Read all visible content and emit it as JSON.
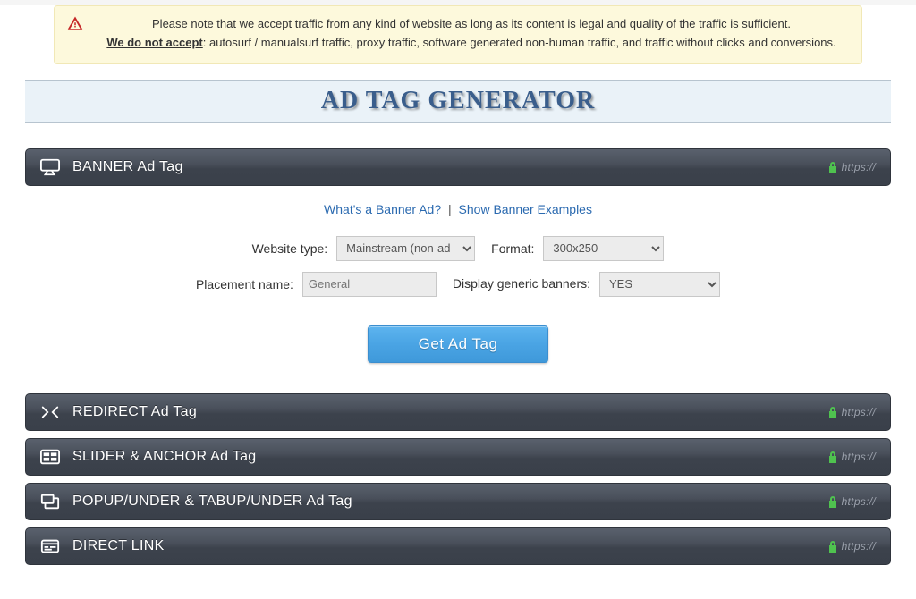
{
  "notice": {
    "line1": "Please note that we accept traffic from any kind of website as long as its content is legal and quality of the traffic is sufficient.",
    "bold": "We do not accept",
    "line2_rest": ": autosurf / manualsurf traffic, proxy traffic, software generated non-human traffic, and traffic without clicks and conversions."
  },
  "page_title": "AD TAG GENERATOR",
  "help": {
    "what_is": "What's a Banner Ad?",
    "show_examples": "Show Banner Examples",
    "separator": "|"
  },
  "form": {
    "website_type_label": "Website type:",
    "website_type_value": "Mainstream (non-ad",
    "format_label": "Format:",
    "format_value": "300x250",
    "placement_label": "Placement name:",
    "placement_placeholder": "General",
    "generic_label": "Display generic banners:",
    "generic_value": "YES",
    "submit": "Get Ad Tag"
  },
  "panels": [
    {
      "label": "BANNER Ad Tag",
      "https": "https://"
    },
    {
      "label": "REDIRECT Ad Tag",
      "https": "https://"
    },
    {
      "label": "SLIDER & ANCHOR Ad Tag",
      "https": "https://"
    },
    {
      "label": "POPUP/UNDER & TABUP/UNDER Ad Tag",
      "https": "https://"
    },
    {
      "label": "DIRECT LINK",
      "https": "https://"
    }
  ]
}
